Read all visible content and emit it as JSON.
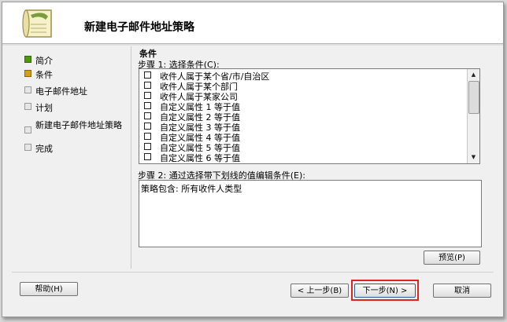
{
  "window": {
    "title": "新建电子邮件地址策略"
  },
  "nav": {
    "items": [
      {
        "label": "简介",
        "state": "done"
      },
      {
        "label": "条件",
        "state": "current"
      },
      {
        "label": "电子邮件地址",
        "state": "pending"
      },
      {
        "label": "计划",
        "state": "pending"
      },
      {
        "label": "新建电子邮件地址策略",
        "state": "pending"
      },
      {
        "label": "完成",
        "state": "pending"
      }
    ]
  },
  "main": {
    "section_title": "条件",
    "step1_label": "步骤 1: 选择条件(C):",
    "conditions": [
      {
        "label": "收件人属于某个省/市/自治区",
        "checked": false
      },
      {
        "label": "收件人属于某个部门",
        "checked": false
      },
      {
        "label": "收件人属于某家公司",
        "checked": false
      },
      {
        "label": "自定义属性 1 等于值",
        "checked": false
      },
      {
        "label": "自定义属性 2 等于值",
        "checked": false
      },
      {
        "label": "自定义属性 3 等于值",
        "checked": false
      },
      {
        "label": "自定义属性 4 等于值",
        "checked": false
      },
      {
        "label": "自定义属性 5 等于值",
        "checked": false
      },
      {
        "label": "自定义属性 6 等于值",
        "checked": false
      }
    ],
    "step2_label": "步骤 2: 通过选择带下划线的值编辑条件(E):",
    "policy_text": "策略包含: 所有收件人类型"
  },
  "buttons": {
    "preview": "预览(P)",
    "help": "帮助(H)",
    "back": "< 上一步(B)",
    "next": "下一步(N) >",
    "cancel": "取消"
  },
  "colors": {
    "highlight": "#e0261c",
    "done": "#4e9a06",
    "current": "#d4a017"
  }
}
